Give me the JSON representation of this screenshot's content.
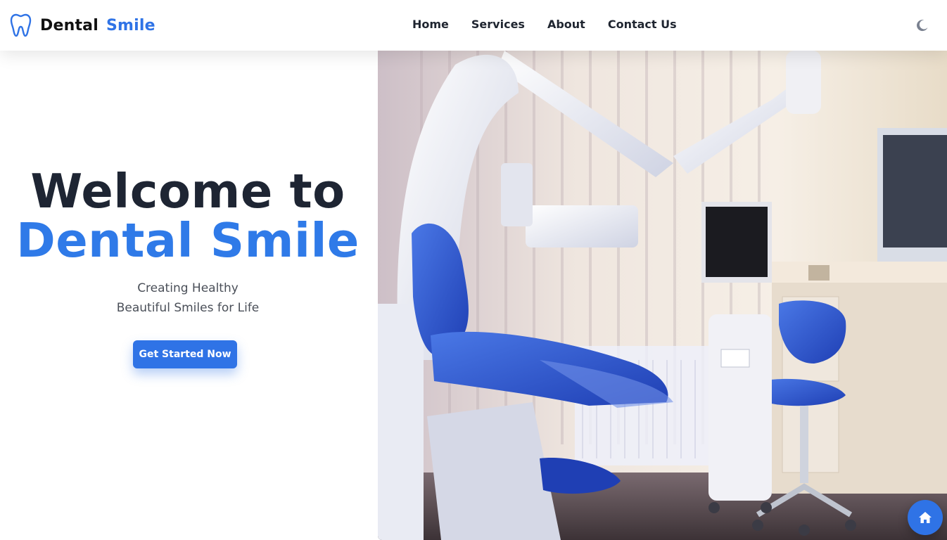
{
  "header": {
    "brand_part1": "Dental",
    "brand_part2": "Smile",
    "brand_icon": "tooth-icon",
    "nav": [
      "Home",
      "Services",
      "About",
      "Contact Us"
    ],
    "theme_icon": "moon-icon"
  },
  "hero": {
    "title_line1": "Welcome to",
    "title_line2": "Dental Smile",
    "subtitle_line1": "Creating Healthy",
    "subtitle_line2": "Beautiful Smiles for Life",
    "cta_label": "Get Started Now"
  },
  "image": {
    "alt": "Dental clinic treatment room"
  },
  "fab": {
    "icon": "home-icon"
  },
  "colors": {
    "accent": "#2f73e6",
    "heading": "#1e2533",
    "text": "#4a4f58"
  }
}
